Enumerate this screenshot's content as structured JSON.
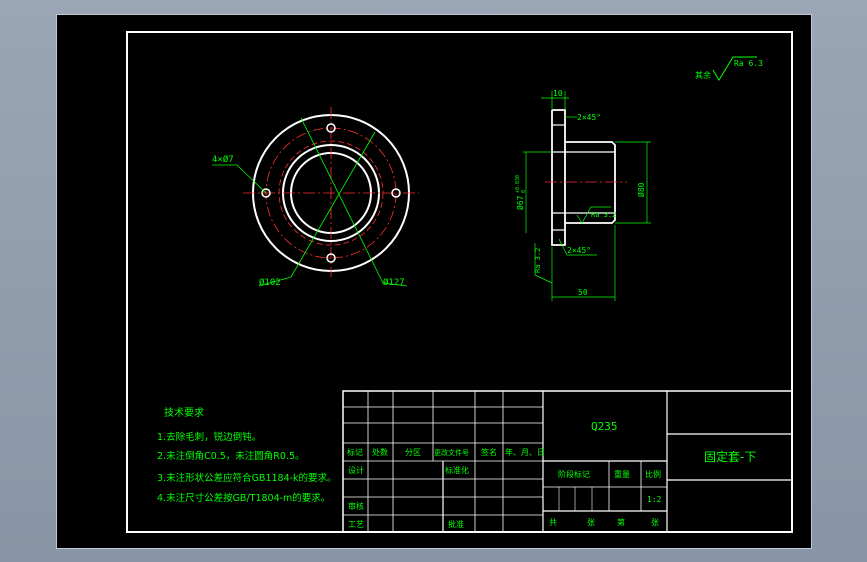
{
  "colors": {
    "background": "#000000",
    "frame": "#ffffff",
    "text": "#00ff00",
    "centerline": "#ff3030",
    "outline": "#ffffff",
    "dimension": "#00ff00",
    "hatch_hint": "#00cc44"
  },
  "surface_finish": {
    "note": "其余",
    "value": "Ra 6.3"
  },
  "front_view": {
    "holes_label": "4×Ø7",
    "bolt_circle_label": "Ø102",
    "outer_label": "Ø127"
  },
  "side_view": {
    "flange_thickness": "10",
    "top_chamfer": "2×45°",
    "bottom_chamfer": "2×45°",
    "bore_label": "Ø67",
    "bore_tol_upper": "+0.030",
    "bore_tol_lower": "0",
    "outer_label": "Ø80",
    "bore_roughness": "Ra 3.2",
    "face_roughness": "Ra 3.2",
    "length": "50"
  },
  "tech_requirements": {
    "title": "技术要求",
    "items": [
      "1.去除毛刺，锐边倒钝。",
      "2.未注倒角C0.5，未注圆角R0.5。",
      "3.未注形状公差应符合GB1184-k的要求。",
      "4.未注尺寸公差按GB/T1804-m的要求。"
    ]
  },
  "title_block": {
    "material": "Q235",
    "part_name": "固定套-下",
    "header_cells": [
      "标记",
      "处数",
      "分区",
      "更改文件号",
      "签名",
      "年、月、日"
    ],
    "design": "设计",
    "standardization": "标准化",
    "review": "审核",
    "process": "工艺",
    "approve": "批准",
    "stage_mark": "阶段标记",
    "weight": "重量",
    "scale": "比例",
    "scale_value": "1:2",
    "total": "共",
    "sheets": "张",
    "sheet_no": "第",
    "sheet_unit": "张"
  }
}
